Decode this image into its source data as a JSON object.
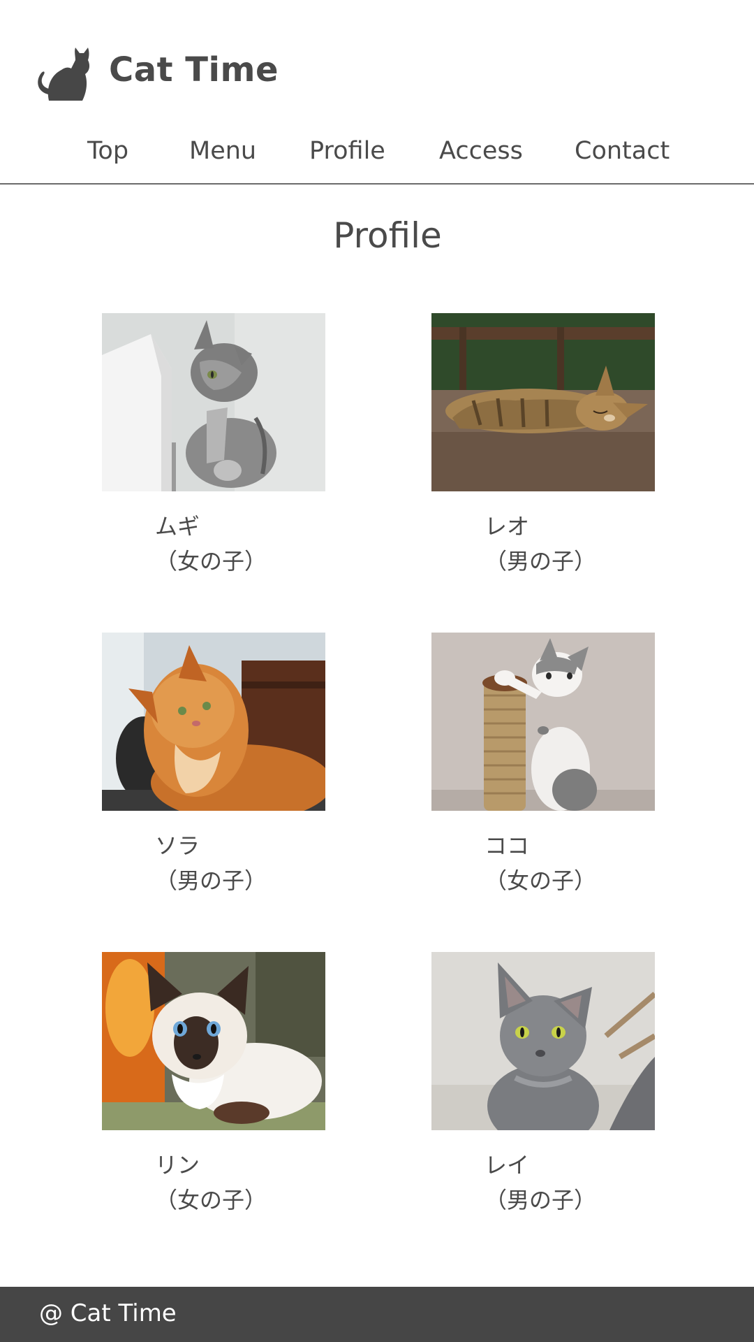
{
  "site": {
    "title": "Cat Time"
  },
  "nav": {
    "items": [
      {
        "label": "Top"
      },
      {
        "label": "Menu"
      },
      {
        "label": "Profile"
      },
      {
        "label": "Access"
      },
      {
        "label": "Contact"
      }
    ]
  },
  "main": {
    "heading": "Profile",
    "cats": [
      {
        "name": "ムギ",
        "gender": "（女の子）"
      },
      {
        "name": "レオ",
        "gender": "（男の子）"
      },
      {
        "name": "ソラ",
        "gender": "（男の子）"
      },
      {
        "name": "ココ",
        "gender": "（女の子）"
      },
      {
        "name": "リン",
        "gender": "（女の子）"
      },
      {
        "name": "レイ",
        "gender": "（男の子）"
      }
    ]
  },
  "footer": {
    "text": "@ Cat Time"
  },
  "colors": {
    "text": "#4a4a4a",
    "footer_bg": "#464646",
    "divider": "#6b6b6b"
  }
}
